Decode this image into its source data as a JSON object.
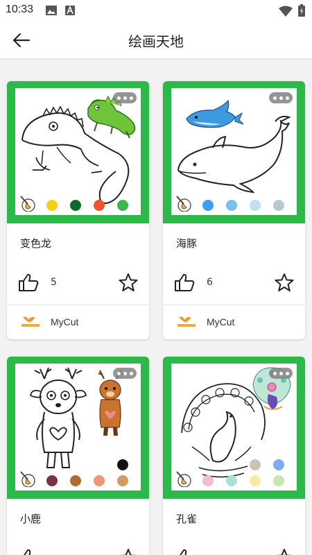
{
  "status_bar": {
    "time": "10:33"
  },
  "app_bar": {
    "title": "绘画天地"
  },
  "cards": [
    {
      "name": "变色龙",
      "likes": "5",
      "author": "MyCut",
      "palette": [
        "#f5cf16",
        "#0c6a2c",
        "#f2542a",
        "#3bb84c"
      ]
    },
    {
      "name": "海豚",
      "likes": "6",
      "author": "MyCut",
      "palette": [
        "#3d9df2",
        "#7cbdf2",
        "#bfe0f0",
        "#b4c9d2"
      ]
    },
    {
      "name": "小鹿",
      "palette": [
        "#7b3340",
        "#b56b30",
        "#f29478",
        "#d39a5f"
      ],
      "extra_color": "#111111"
    },
    {
      "name": "孔雀",
      "palette": [
        "#f1bcd1",
        "#a8e2d6",
        "#fde9a3",
        "#c9e6ab"
      ],
      "extra_colors": [
        "#c7c4b3",
        "#7eaaf2"
      ]
    }
  ]
}
